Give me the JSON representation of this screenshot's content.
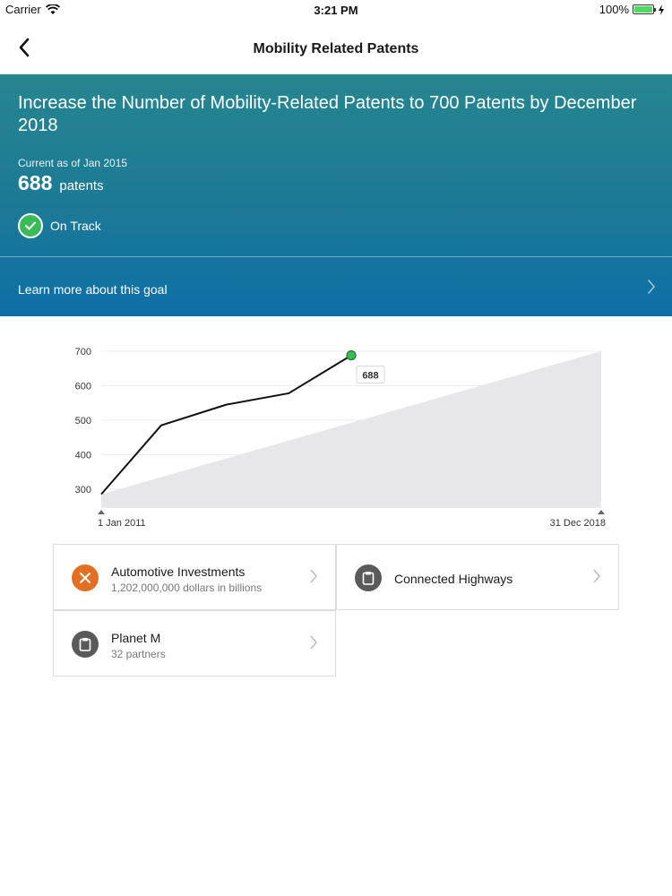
{
  "status_bar": {
    "carrier": "Carrier",
    "time": "3:21 PM",
    "battery": "100%",
    "battery_level": 1.0
  },
  "nav": {
    "title": "Mobility Related Patents",
    "back_icon": "chevron-left-icon"
  },
  "goal": {
    "title": "Increase the Number of Mobility-Related Patents to 700 Patents by December 2018",
    "current_as_of": "Current as of Jan 2015",
    "value": "688",
    "unit": "patents",
    "status": "On Track",
    "status_color": "#3cba57",
    "learn_more": "Learn more about this goal"
  },
  "chart_data": {
    "type": "line",
    "x_start_label": "1 Jan 2011",
    "x_end_label": "31 Dec 2018",
    "yticks": [
      700,
      600,
      500,
      400,
      300
    ],
    "ylim": [
      245,
      700
    ],
    "series": [
      {
        "x": [
          0,
          0.12,
          0.25,
          0.375,
          0.5
        ],
        "values": [
          285,
          485,
          545,
          578,
          688
        ]
      }
    ],
    "target_band": {
      "start": 285,
      "end": 700
    },
    "last_value_label": "688",
    "x_range": [
      0,
      1
    ]
  },
  "cards": [
    {
      "title": "Automotive Investments",
      "subtitle": "1,202,000,000 dollars in billions",
      "icon": "x-icon",
      "icon_color": "#e36f24"
    },
    {
      "title": "Connected Highways",
      "subtitle": "",
      "icon": "clipboard-icon",
      "icon_color": "#5a5a5a"
    },
    {
      "title": "Planet M",
      "subtitle": "32 partners",
      "icon": "clipboard-icon",
      "icon_color": "#5a5a5a"
    }
  ]
}
